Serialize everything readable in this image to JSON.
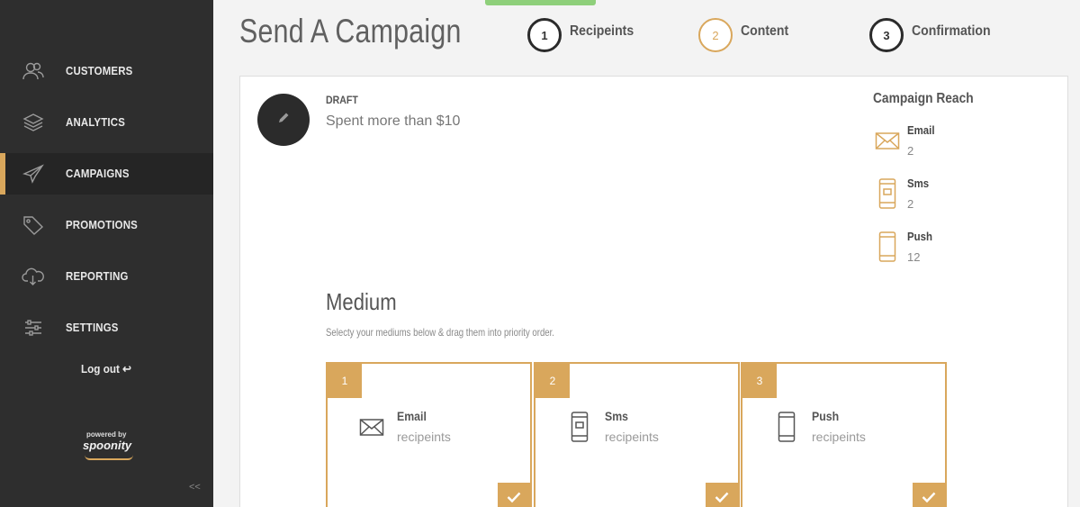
{
  "sidebar": {
    "items": [
      {
        "label": "CUSTOMERS",
        "icon": "customers-icon"
      },
      {
        "label": "ANALYTICS",
        "icon": "layers-icon"
      },
      {
        "label": "CAMPAIGNS",
        "icon": "paper-plane-icon"
      },
      {
        "label": "PROMOTIONS",
        "icon": "tag-icon"
      },
      {
        "label": "REPORTING",
        "icon": "cloud-download-icon"
      },
      {
        "label": "SETTINGS",
        "icon": "sliders-icon"
      }
    ],
    "active_item": "CAMPAIGNS",
    "logout_label": "Log out ↩",
    "powered_by": "powered by",
    "brand": "spoonity",
    "collapse": "<<"
  },
  "header": {
    "title": "Send A Campaign",
    "steps": [
      {
        "number": "1",
        "label": "Recipeints"
      },
      {
        "number": "2",
        "label": "Content"
      },
      {
        "number": "3",
        "label": "Confirmation"
      }
    ],
    "current_step": "2"
  },
  "campaign": {
    "status": "DRAFT",
    "name": "Spent more than $10"
  },
  "reach": {
    "title": "Campaign Reach",
    "items": [
      {
        "name": "Email",
        "count": "2",
        "icon": "envelope-icon"
      },
      {
        "name": "Sms",
        "count": "2",
        "icon": "sms-phone-icon"
      },
      {
        "name": "Push",
        "count": "12",
        "icon": "push-phone-icon"
      }
    ]
  },
  "medium": {
    "title": "Medium",
    "subtitle": "Selecty your mediums below & drag them into priority order.",
    "cards": [
      {
        "number": "1",
        "name": "Email",
        "desc": "recipeints",
        "icon": "envelope-icon"
      },
      {
        "number": "2",
        "name": "Sms",
        "desc": "recipeints",
        "icon": "sms-phone-icon"
      },
      {
        "number": "3",
        "name": "Push",
        "desc": "recipeints",
        "icon": "push-phone-icon"
      }
    ]
  },
  "colors": {
    "accent": "#d9a75c",
    "sidebar_bg": "#2e2e2e",
    "progress_green": "#8ecf7a"
  }
}
